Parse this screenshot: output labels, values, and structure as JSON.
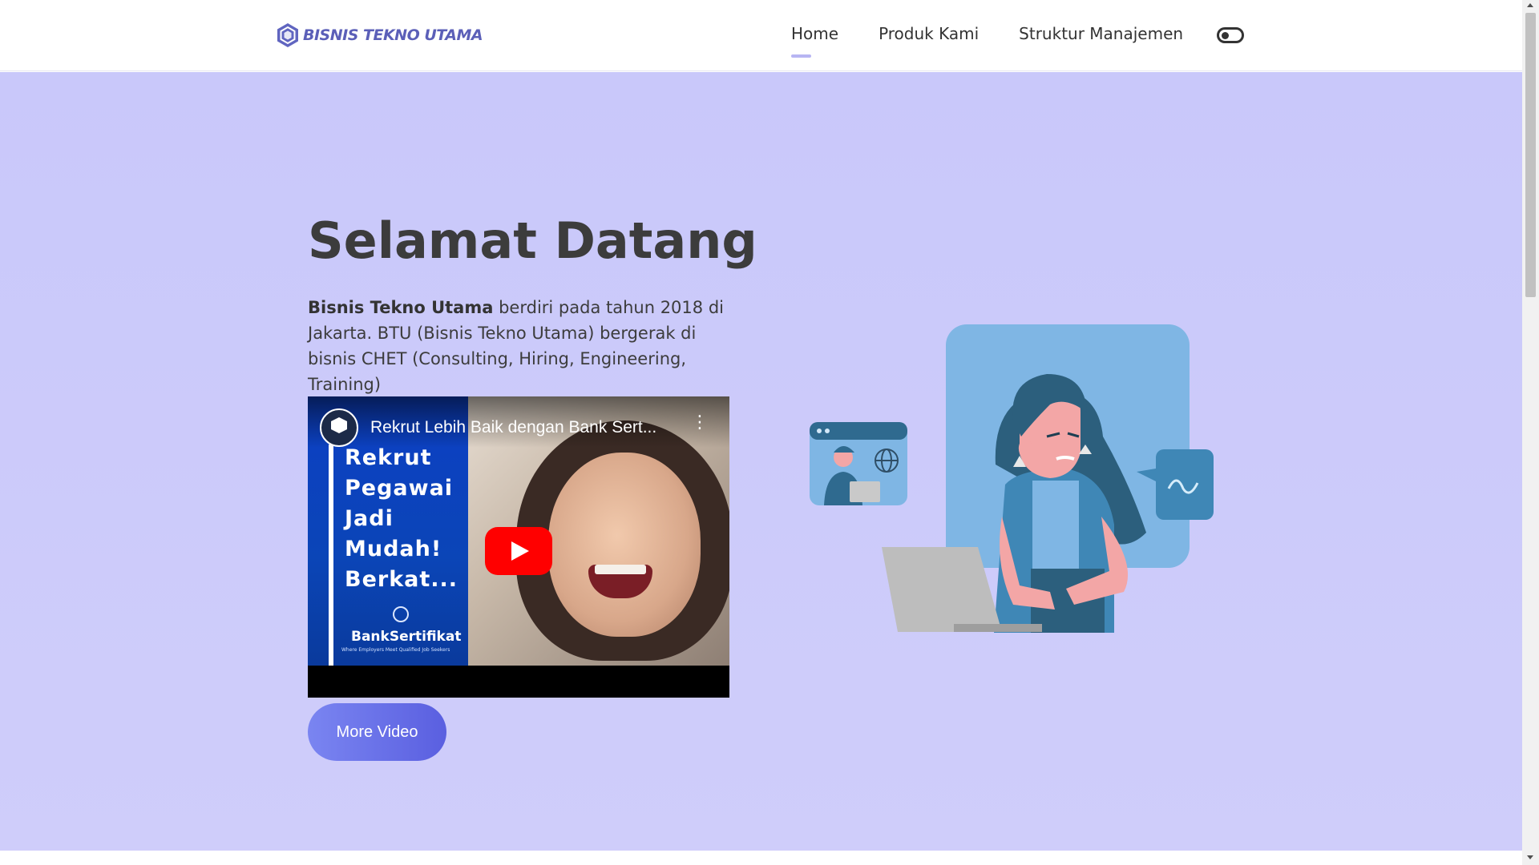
{
  "header": {
    "brand": "BISNIS TEKNO UTAMA",
    "nav": [
      {
        "label": "Home",
        "active": true
      },
      {
        "label": "Produk Kami"
      },
      {
        "label": "Struktur Manajemen"
      }
    ],
    "theme_toggle_icon": "toggle-icon"
  },
  "hero": {
    "title": "Selamat Datang",
    "desc_bold": "Bisnis Tekno Utama",
    "desc_rest": " berdiri pada tahun 2018 di Jakarta. BTU (Bisnis Tekno Utama) bergerak di bisnis CHET (Consulting, Hiring, Engineering, Training)",
    "video": {
      "title": "Rekrut Lebih Baik dengan Bank Sert...",
      "thumbnail_lines": [
        "Rekrut",
        "Pegawai",
        "Jadi",
        "Mudah!",
        "Berkat..."
      ],
      "brand": "BankSertifikat",
      "tagline": "Where Employers Meet Qualified Job Seekers",
      "play_icon": "play-icon",
      "menu_icon": "more-vertical-icon"
    },
    "button_label": "More Video"
  },
  "colors": {
    "hero_bg": "#c9c8fa",
    "brand": "#5b5fb8",
    "button": "#5a5fe0",
    "youtube_red": "#ff0000"
  }
}
